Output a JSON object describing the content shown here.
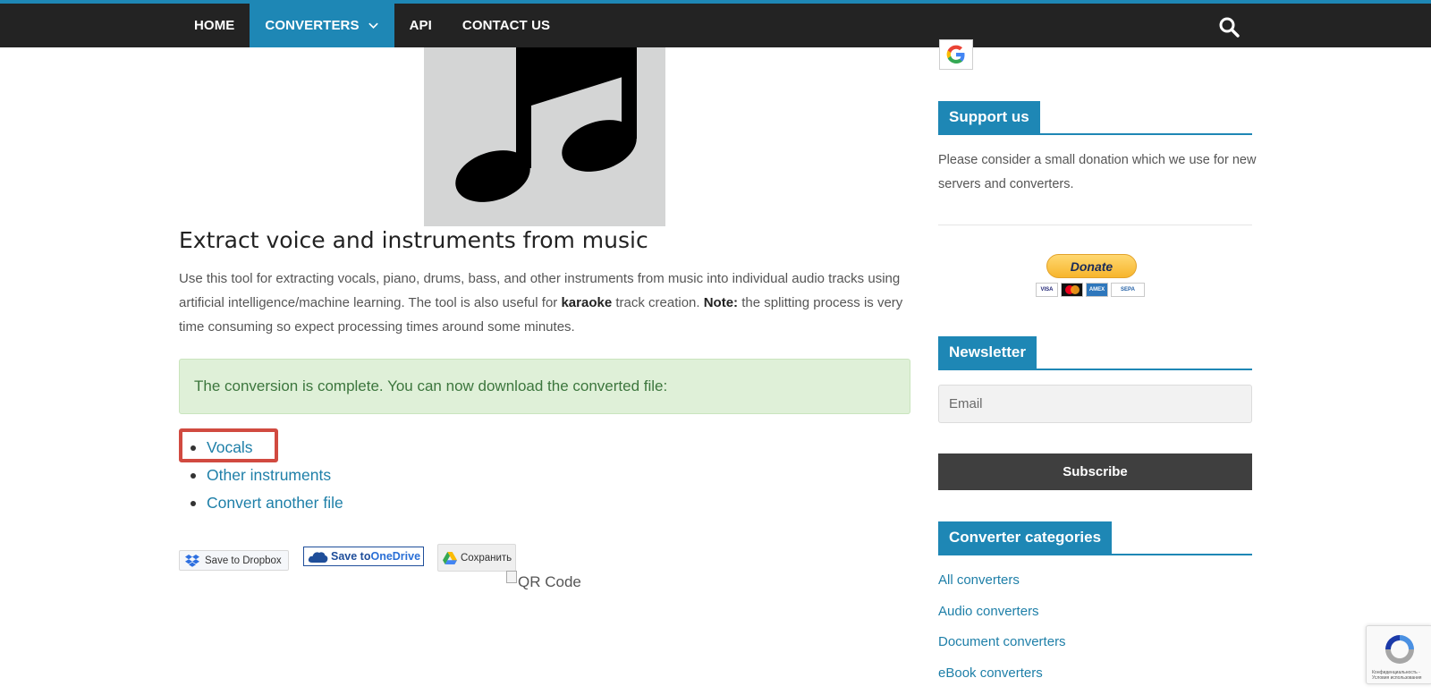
{
  "nav": {
    "items": [
      {
        "label": "HOME"
      },
      {
        "label": "CONVERTERS"
      },
      {
        "label": "API"
      },
      {
        "label": "CONTACT US"
      }
    ]
  },
  "main": {
    "title": "Extract voice and instruments from music",
    "description": {
      "part1": "Use this tool for extracting vocals, piano, drums, bass, and other instruments from music into individual audio tracks using artificial intelligence/machine learning. The tool is also useful for ",
      "bold1": "karaoke",
      "part2": " track creation. ",
      "bold2": "Note:",
      "part3": " the splitting process is very time consuming so expect processing times around some minutes."
    },
    "alert": "The conversion is complete. You can now download the converted file:",
    "downloads": [
      {
        "label": "Vocals"
      },
      {
        "label": "Other instruments"
      },
      {
        "label": "Convert another file"
      }
    ],
    "save_buttons": {
      "dropbox": "Save to Dropbox",
      "onedrive_prefix": "Save to ",
      "onedrive_brand": "OneDrive",
      "gdrive": "Сохранить"
    },
    "qr_alt": "QR Code"
  },
  "sidebar": {
    "support": {
      "title": "Support us",
      "text": "Please consider a small donation which we use for new servers and converters.",
      "donate_label": "Donate",
      "cards": [
        "VISA",
        "",
        "AMEX",
        "SEPA"
      ]
    },
    "newsletter": {
      "title": "Newsletter",
      "email_placeholder": "Email",
      "subscribe_label": "Subscribe"
    },
    "categories": {
      "title": "Converter categories",
      "items": [
        "All converters",
        "Audio converters",
        "Document converters",
        "eBook converters"
      ]
    }
  },
  "recaptcha": {
    "text": "Конфиденциальность - Условия использования"
  },
  "colors": {
    "nav_bg": "#232323",
    "accent": "#1e87b5",
    "link": "#1e7fa8",
    "alert_bg": "#dff0d8",
    "alert_text": "#3c763d",
    "highlight": "#d14a40"
  }
}
